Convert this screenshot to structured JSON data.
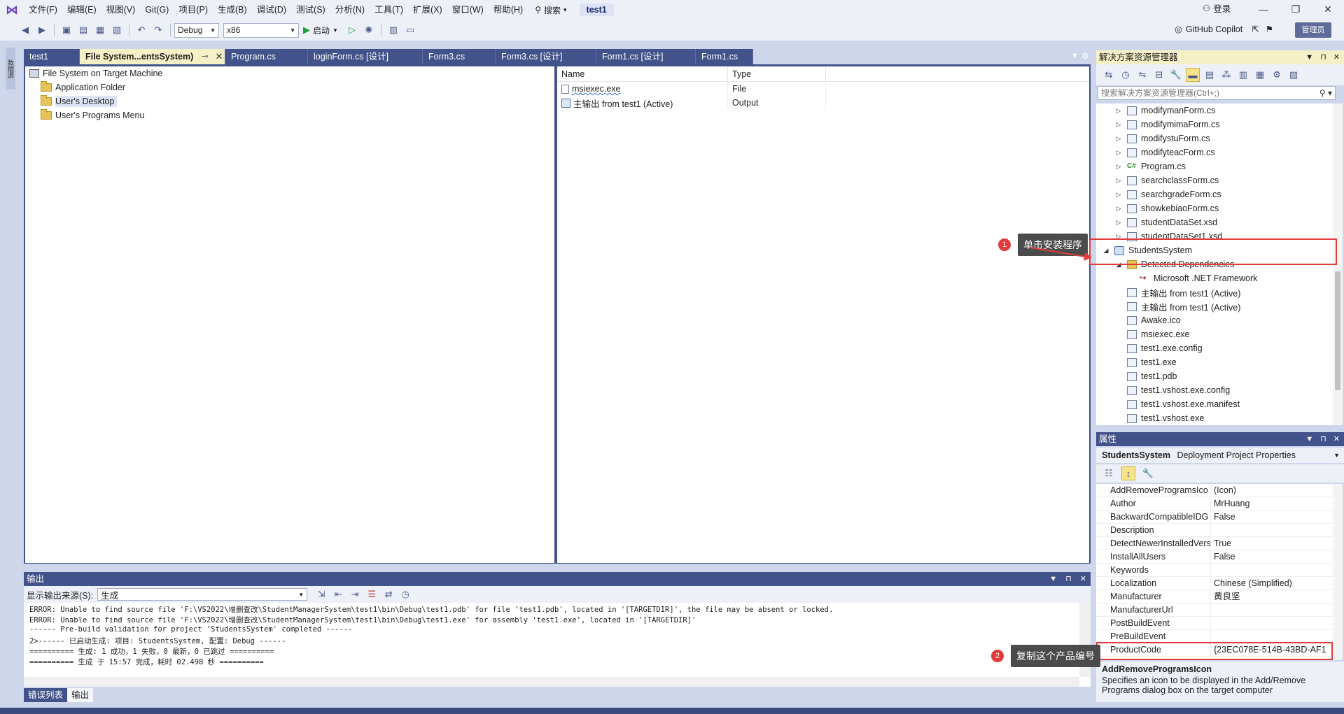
{
  "menubar": {
    "items": [
      "文件(F)",
      "编辑(E)",
      "视图(V)",
      "Git(G)",
      "项目(P)",
      "生成(B)",
      "调试(D)",
      "测试(S)",
      "分析(N)",
      "工具(T)",
      "扩展(X)",
      "窗口(W)",
      "帮助(H)"
    ],
    "search_label": "搜索",
    "solution_name": "test1",
    "login_label": "登录"
  },
  "toolbar": {
    "config": "Debug",
    "platform": "x86",
    "start_label": "启动",
    "copilot_label": "GitHub Copilot",
    "admin_label": "管理员"
  },
  "doc_tabs": [
    {
      "label": "test1",
      "active": false
    },
    {
      "label": "File System...entsSystem)",
      "active": true
    },
    {
      "label": "Program.cs",
      "active": false
    },
    {
      "label": "loginForm.cs [设计]",
      "active": false
    },
    {
      "label": "Form3.cs",
      "active": false
    },
    {
      "label": "Form3.cs [设计]",
      "active": false
    },
    {
      "label": "Form1.cs [设计]",
      "active": false
    },
    {
      "label": "Form1.cs",
      "active": false
    }
  ],
  "fs_tree": {
    "root": "File System on Target Machine",
    "folders": [
      "Application Folder",
      "User's Desktop",
      "User's Programs Menu"
    ],
    "selected": "User's Desktop"
  },
  "fs_list": {
    "columns": [
      "Name",
      "Type"
    ],
    "rows": [
      {
        "name": "msiexec.exe",
        "type": "File"
      },
      {
        "name": "主输出 from test1 (Active)",
        "type": "Output"
      }
    ]
  },
  "output": {
    "title": "输出",
    "source_label": "显示输出来源(S):",
    "source_value": "生成",
    "lines": [
      "ERROR: Unable to find source file 'F:\\VS2022\\增删查改\\StudentManagerSystem\\test1\\bin\\Debug\\test1.pdb' for file 'test1.pdb', located in '[TARGETDIR]', the file may be absent or locked.",
      "ERROR: Unable to find source file 'F:\\VS2022\\增删查改\\StudentManagerSystem\\test1\\bin\\Debug\\test1.exe' for assembly 'test1.exe', located in '[TARGETDIR]'",
      "------ Pre-build validation for project 'StudentsSystem' completed ------",
      "2>------ 已启动生成: 项目: StudentsSystem, 配置: Debug ------",
      "========== 生成: 1 成功，1 失败，0 最新，0 已跳过 ==========",
      "========== 生成 于 15:57 完成，耗时 02.498 秒 =========="
    ],
    "bottom_tabs": [
      "错误列表",
      "输出"
    ]
  },
  "solution_explorer": {
    "title": "解决方案资源管理器",
    "search_placeholder": "搜索解决方案资源管理器(Ctrl+;)",
    "items": [
      {
        "label": "modifymanForm.cs",
        "level": 1,
        "arrow": "▷",
        "icon": "form"
      },
      {
        "label": "modifymimaForm.cs",
        "level": 1,
        "arrow": "▷",
        "icon": "form"
      },
      {
        "label": "modifystuForm.cs",
        "level": 1,
        "arrow": "▷",
        "icon": "form"
      },
      {
        "label": "modifyteacForm.cs",
        "level": 1,
        "arrow": "▷",
        "icon": "form"
      },
      {
        "label": "Program.cs",
        "level": 1,
        "arrow": "▷",
        "icon": "cs"
      },
      {
        "label": "searchclassForm.cs",
        "level": 1,
        "arrow": "▷",
        "icon": "form"
      },
      {
        "label": "searchgradeForm.cs",
        "level": 1,
        "arrow": "▷",
        "icon": "form"
      },
      {
        "label": "showkebiaoForm.cs",
        "level": 1,
        "arrow": "▷",
        "icon": "form"
      },
      {
        "label": "studentDataSet.xsd",
        "level": 1,
        "arrow": "▷",
        "icon": "form"
      },
      {
        "label": "studentDataSet1.xsd",
        "level": 1,
        "arrow": "▷",
        "icon": "form"
      },
      {
        "label": "StudentsSystem",
        "level": 0,
        "arrow": "◢",
        "icon": "proj"
      },
      {
        "label": "Detected Dependencies",
        "level": 1,
        "arrow": "◢",
        "icon": "folder"
      },
      {
        "label": "Microsoft .NET Framework",
        "level": 2,
        "arrow": "",
        "icon": "ref"
      },
      {
        "label": "主输出 from test1 (Active)",
        "level": 1,
        "arrow": "",
        "icon": "form"
      },
      {
        "label": "主输出 from test1 (Active)",
        "level": 1,
        "arrow": "",
        "icon": "form"
      },
      {
        "label": "Awake.ico",
        "level": 1,
        "arrow": "",
        "icon": "file"
      },
      {
        "label": "msiexec.exe",
        "level": 1,
        "arrow": "",
        "icon": "file"
      },
      {
        "label": "test1.exe.config",
        "level": 1,
        "arrow": "",
        "icon": "file"
      },
      {
        "label": "test1.exe",
        "level": 1,
        "arrow": "",
        "icon": "file"
      },
      {
        "label": "test1.pdb",
        "level": 1,
        "arrow": "",
        "icon": "file"
      },
      {
        "label": "test1.vshost.exe.config",
        "level": 1,
        "arrow": "",
        "icon": "file"
      },
      {
        "label": "test1.vshost.exe.manifest",
        "level": 1,
        "arrow": "",
        "icon": "file"
      },
      {
        "label": "test1.vshost.exe",
        "level": 1,
        "arrow": "",
        "icon": "file"
      }
    ]
  },
  "properties": {
    "title": "属性",
    "object_name": "StudentsSystem",
    "object_type": "Deployment Project Properties",
    "rows": [
      {
        "name": "AddRemoveProgramsIco",
        "value": "(Icon)"
      },
      {
        "name": "Author",
        "value": "MrHuang"
      },
      {
        "name": "BackwardCompatibleIDG",
        "value": "False"
      },
      {
        "name": "Description",
        "value": ""
      },
      {
        "name": "DetectNewerInstalledVers",
        "value": "True"
      },
      {
        "name": "InstallAllUsers",
        "value": "False"
      },
      {
        "name": "Keywords",
        "value": ""
      },
      {
        "name": "Localization",
        "value": "Chinese (Simplified)"
      },
      {
        "name": "Manufacturer",
        "value": "黄良坚"
      },
      {
        "name": "ManufacturerUrl",
        "value": ""
      },
      {
        "name": "PostBuildEvent",
        "value": ""
      },
      {
        "name": "PreBuildEvent",
        "value": ""
      },
      {
        "name": "ProductCode",
        "value": "{23EC078E-514B-43BD-AF1"
      }
    ],
    "desc_title": "AddRemoveProgramsIcon",
    "desc_text": "Specifies an icon to be displayed in the Add/Remove Programs dialog box on the target computer"
  },
  "annotations": {
    "step1_num": "1",
    "step1_label": "单击安装程序",
    "step2_num": "2",
    "step2_label": "复制这个产品编号",
    "highlight_color": "#e23b3b"
  },
  "left_strip_label": "数据源"
}
